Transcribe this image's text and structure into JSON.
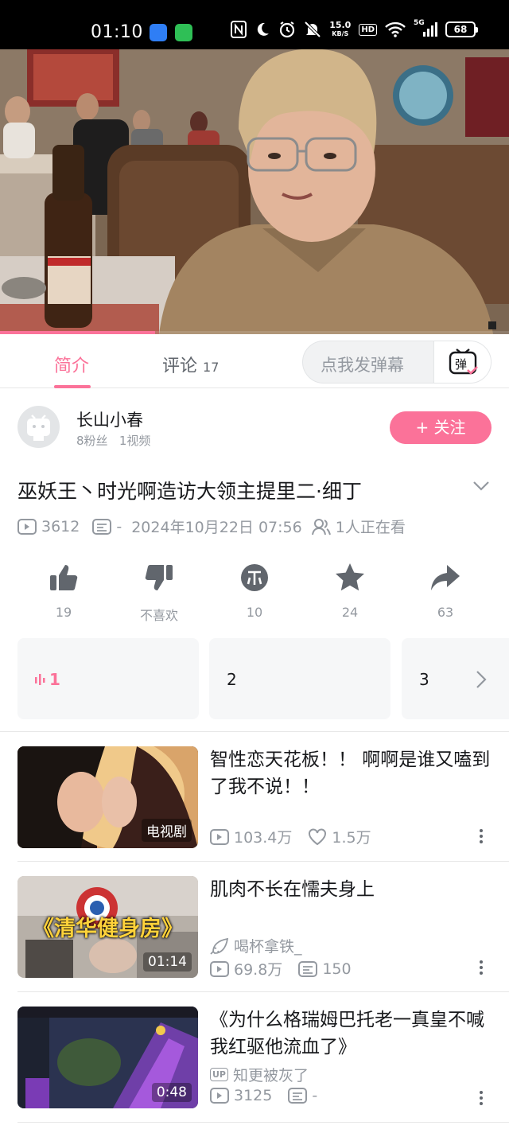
{
  "status_bar": {
    "time": "01:10",
    "speed_value": "15.0",
    "speed_unit": "KB/S",
    "hd": "HD",
    "network": "5G",
    "battery": "68"
  },
  "video": {
    "progress": 0.305
  },
  "tabs": [
    {
      "label": "简介",
      "count": ""
    },
    {
      "label": "评论",
      "count": "17"
    }
  ],
  "danmu": {
    "placeholder": "点我发弹幕",
    "button": "弹"
  },
  "uploader": {
    "name": "长山小春",
    "fans": "8粉丝",
    "videos": "1视频",
    "follow_label": "+ 关注"
  },
  "video_info": {
    "title": "巫妖王丶时光啊造访大领主提里二·细丁",
    "views": "3612",
    "danmaku": "-",
    "date": "2024年10月22日 07:56",
    "watching": "1人正在看"
  },
  "actions": [
    {
      "icon": "thumbs-up-icon",
      "label": "19"
    },
    {
      "icon": "thumbs-down-icon",
      "label": "不喜欢"
    },
    {
      "icon": "coin-icon",
      "label": "10"
    },
    {
      "icon": "star-icon",
      "label": "24"
    },
    {
      "icon": "share-icon",
      "label": "63"
    }
  ],
  "episodes": [
    "1",
    "2",
    "3"
  ],
  "recommendations": [
    {
      "title": "智性恋天花板！！ 啊啊是谁又嗑到了我不说！！",
      "badge": "电视剧",
      "views": "103.4万",
      "likes": "1.5万"
    },
    {
      "title": "肌肉不长在懦夫身上",
      "thumb_text": "《清华健身房》",
      "badge": "01:14",
      "author": "喝杯拿铁_",
      "views": "69.8万",
      "danmaku": "150"
    },
    {
      "title": "《为什么格瑞姆巴托老一真皇不喊我红驱他流血了》",
      "badge": "0:48",
      "author_tag": "UP",
      "author": "知更被灰了",
      "views": "3125",
      "danmaku": "-"
    }
  ],
  "colors": {
    "accent": "#fb7299",
    "text": "#18191c",
    "muted": "#9499a0",
    "icon": "#61666d"
  }
}
